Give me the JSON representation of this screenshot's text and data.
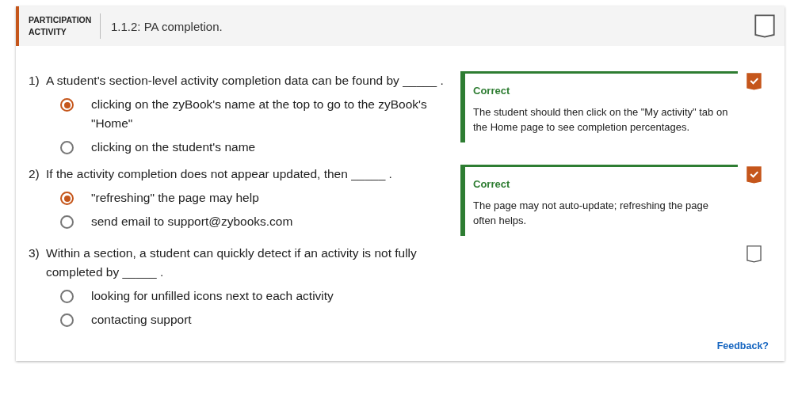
{
  "header": {
    "label": "PARTICIPATION ACTIVITY",
    "title": "1.1.2: PA completion.",
    "completed": false
  },
  "questions": [
    {
      "number": "1)",
      "text": "A student's section-level activity completion data can be found by _____ .",
      "completed": true,
      "options": [
        {
          "text": "clicking on the zyBook's name at the top to go to the zyBook's \"Home\"",
          "selected": true
        },
        {
          "text": "clicking on the student's name",
          "selected": false
        }
      ],
      "feedback": {
        "title": "Correct",
        "text": "The student should then click on the \"My activity\" tab on the Home page to see completion percentages."
      }
    },
    {
      "number": "2)",
      "text": "If the activity completion does not appear updated, then _____ .",
      "completed": true,
      "options": [
        {
          "text": "\"refreshing\" the page may help",
          "selected": true
        },
        {
          "text": "send email to support@zybooks.com",
          "selected": false
        }
      ],
      "feedback": {
        "title": "Correct",
        "text": "The page may not auto-update; refreshing the page often helps."
      }
    },
    {
      "number": "3)",
      "text": "Within a section, a student can quickly detect if an activity is not fully completed by _____ .",
      "completed": false,
      "options": [
        {
          "text": "looking for unfilled icons next to each activity",
          "selected": false
        },
        {
          "text": "contacting support",
          "selected": false
        }
      ]
    }
  ],
  "feedback_link": "Feedback?"
}
